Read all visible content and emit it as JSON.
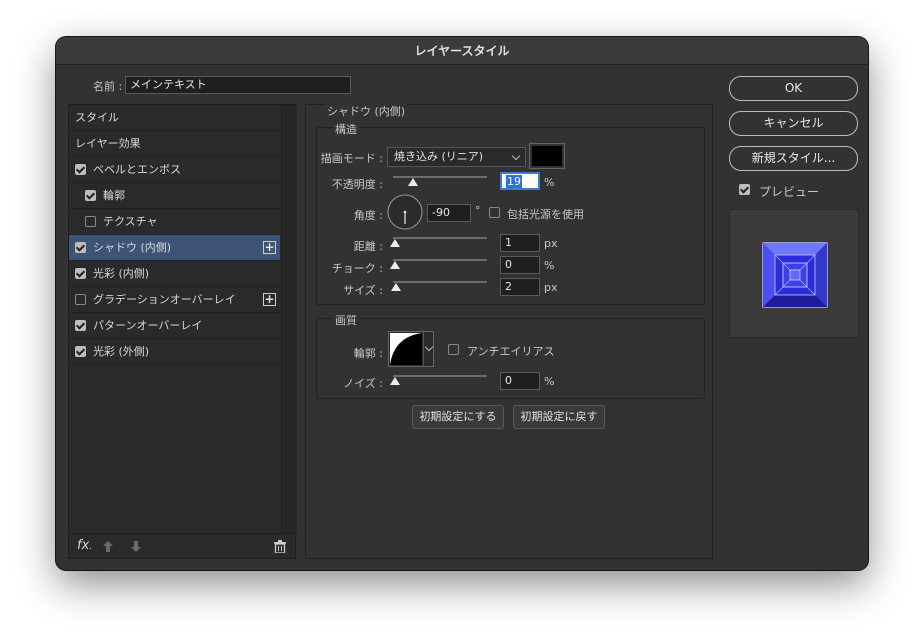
{
  "window": {
    "title": "レイヤースタイル"
  },
  "name_field": {
    "label": "名前 :",
    "value": "メインテキスト"
  },
  "style_list": {
    "items": [
      {
        "label": "スタイル",
        "checkbox": "none",
        "plus": false,
        "selected": false,
        "indent": 0
      },
      {
        "label": "レイヤー効果",
        "checkbox": "none",
        "plus": false,
        "selected": false,
        "indent": 0
      },
      {
        "label": "ベベルとエンボス",
        "checkbox": "on",
        "plus": false,
        "selected": false,
        "indent": 0
      },
      {
        "label": "輪郭",
        "checkbox": "on",
        "plus": false,
        "selected": false,
        "indent": 1
      },
      {
        "label": "テクスチャ",
        "checkbox": "off",
        "plus": false,
        "selected": false,
        "indent": 1
      },
      {
        "label": "シャドウ (内側)",
        "checkbox": "on",
        "plus": true,
        "selected": true,
        "indent": 0
      },
      {
        "label": "光彩 (内側)",
        "checkbox": "on",
        "plus": false,
        "selected": false,
        "indent": 0
      },
      {
        "label": "グラデーションオーバーレイ",
        "checkbox": "off",
        "plus": true,
        "selected": false,
        "indent": 0
      },
      {
        "label": "パターンオーバーレイ",
        "checkbox": "on",
        "plus": false,
        "selected": false,
        "indent": 0
      },
      {
        "label": "光彩 (外側)",
        "checkbox": "on",
        "plus": false,
        "selected": false,
        "indent": 0
      }
    ],
    "fx_label": "fx"
  },
  "panel": {
    "title": "シャドウ (内側)",
    "structure": {
      "title": "構造",
      "blend_mode": {
        "label": "描画モード :",
        "value": "焼き込み (リニア)"
      },
      "opacity": {
        "label": "不透明度 :",
        "value": "19",
        "unit": "%",
        "fraction": 0.19
      },
      "angle": {
        "label": "角度 :",
        "value": "-90",
        "unit": "°",
        "global_label": "包括光源を使用",
        "degrees": -90
      },
      "distance": {
        "label": "距離 :",
        "value": "1",
        "unit": "px",
        "fraction": 0.0
      },
      "choke": {
        "label": "チョーク :",
        "value": "0",
        "unit": "%",
        "fraction": 0.0
      },
      "size": {
        "label": "サイズ :",
        "value": "2",
        "unit": "px",
        "fraction": 0.01
      }
    },
    "quality": {
      "title": "画質",
      "contour": {
        "label": "輪郭 :",
        "antialias_label": "アンチエイリアス"
      },
      "noise": {
        "label": "ノイズ :",
        "value": "0",
        "unit": "%",
        "fraction": 0.0
      }
    },
    "buttons": {
      "make_default": "初期設定にする",
      "reset_default": "初期設定に戻す"
    }
  },
  "side": {
    "ok": "OK",
    "cancel": "キャンセル",
    "new_style": "新規スタイル...",
    "preview_label": "プレビュー"
  },
  "colors": {
    "shadow_color": "#000000",
    "accent": "#3d7bd9",
    "selected_row": "#3e5476"
  }
}
